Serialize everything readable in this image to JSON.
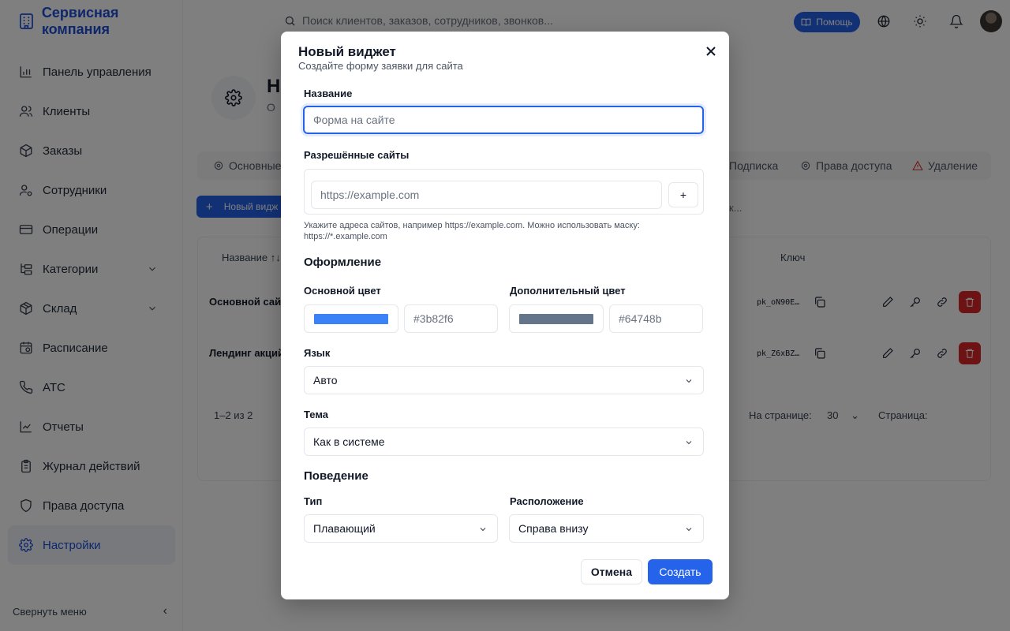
{
  "app": {
    "brand": "Сервисная компания"
  },
  "header": {
    "search_placeholder": "Поиск клиентов, заказов, сотрудников, звонков...",
    "help_label": "Помощь"
  },
  "sidebar": {
    "items": [
      {
        "label": "Панель управления"
      },
      {
        "label": "Клиенты"
      },
      {
        "label": "Заказы"
      },
      {
        "label": "Сотрудники"
      },
      {
        "label": "Операции"
      },
      {
        "label": "Категории"
      },
      {
        "label": "Склад"
      },
      {
        "label": "Расписание"
      },
      {
        "label": "АТС"
      },
      {
        "label": "Отчеты"
      },
      {
        "label": "Журнал действий"
      },
      {
        "label": "Права доступа"
      },
      {
        "label": "Настройки"
      }
    ],
    "collapse_label": "Свернуть меню"
  },
  "page": {
    "title_partial": "Н",
    "subtitle_partial": "О",
    "tabs": [
      "Основные",
      "Подписка",
      "Права доступа",
      "Удаление"
    ],
    "new_widget_label": "Новый видж",
    "search_partial": "к...",
    "table": {
      "col_name": "Название ↑↓",
      "col_key": "Ключ",
      "rows": [
        {
          "name": "Основной сайт",
          "key": "pk_oN90E…"
        },
        {
          "name": "Лендинг акций",
          "key": "pk_Z6xBZ…"
        }
      ]
    },
    "pager": {
      "summary": "1–2 из 2",
      "per_page_label": "На странице:",
      "per_page_value": "30",
      "page_label": "Страница:"
    }
  },
  "modal": {
    "title": "Новый виджет",
    "subtitle": "Создайте форму заявки для сайта",
    "name_label": "Название",
    "name_placeholder": "Форма на сайте",
    "sites_label": "Разрешённые сайты",
    "sites_placeholder": "https://example.com",
    "add_label": "+",
    "sites_hint": "Укажите адреса сайтов, например https://example.com. Можно использовать маску: https://*.example.com",
    "design_heading": "Оформление",
    "primary_color_label": "Основной цвет",
    "primary_color": "#3b82f6",
    "secondary_color_label": "Дополнительный цвет",
    "secondary_color": "#64748b",
    "language_label": "Язык",
    "language_value": "Авто",
    "theme_label": "Тема",
    "theme_value": "Как в системе",
    "behavior_heading": "Поведение",
    "type_label": "Тип",
    "type_value": "Плавающий",
    "position_label": "Расположение",
    "position_value": "Справа внизу",
    "cancel_label": "Отмена",
    "create_label": "Создать"
  },
  "colors": {
    "accent": "#2563eb",
    "danger": "#dc2626"
  }
}
